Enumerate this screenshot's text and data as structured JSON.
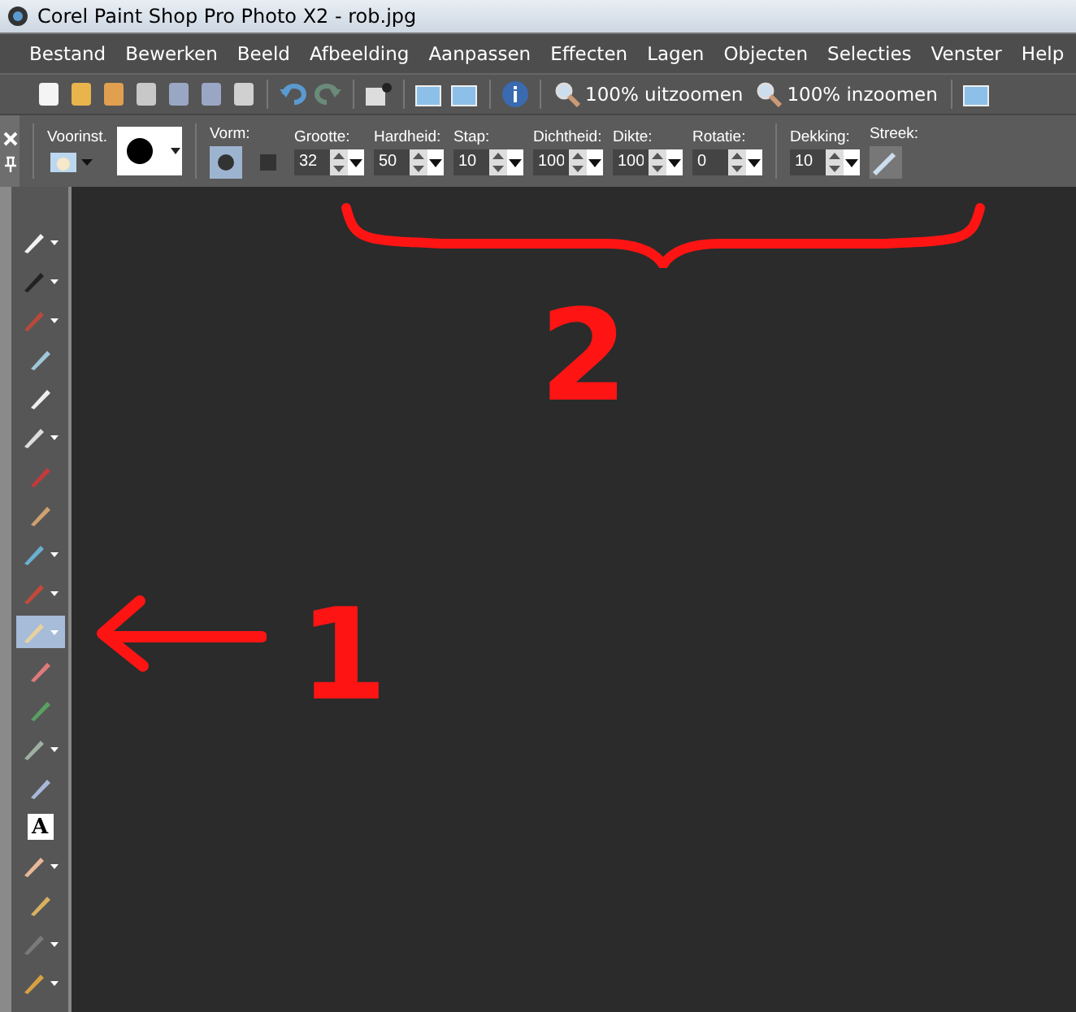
{
  "window": {
    "title": "Corel Paint Shop Pro Photo X2 - rob.jpg"
  },
  "menu": [
    "Bestand",
    "Bewerken",
    "Beeld",
    "Afbeelding",
    "Aanpassen",
    "Effecten",
    "Lagen",
    "Objecten",
    "Selecties",
    "Venster",
    "Help"
  ],
  "toolbar": {
    "zoom_out": "100% uitzoomen",
    "zoom_in": "100% inzoomen"
  },
  "options": {
    "preset_label": "Voorinst.",
    "shape_label": "Vorm:",
    "shapes": [
      {
        "selected": true
      },
      {
        "selected": false
      }
    ],
    "fields": [
      {
        "label": "Grootte:",
        "value": "32"
      },
      {
        "label": "Hardheid:",
        "value": "50"
      },
      {
        "label": "Stap:",
        "value": "10"
      },
      {
        "label": "Dichtheid:",
        "value": "100"
      },
      {
        "label": "Dikte:",
        "value": "100"
      },
      {
        "label": "Rotatie:",
        "value": "0"
      }
    ],
    "opacity": {
      "label": "Dekking:",
      "value": "10"
    },
    "stroke_label": "Streek:"
  },
  "tools": [
    {
      "dropdown": true,
      "selected": false
    },
    {
      "dropdown": true,
      "selected": false
    },
    {
      "dropdown": true,
      "selected": false
    },
    {
      "dropdown": false,
      "selected": false
    },
    {
      "dropdown": false,
      "selected": false
    },
    {
      "dropdown": true,
      "selected": false
    },
    {
      "dropdown": false,
      "selected": false
    },
    {
      "dropdown": false,
      "selected": false
    },
    {
      "dropdown": true,
      "selected": false
    },
    {
      "dropdown": true,
      "selected": false
    },
    {
      "dropdown": true,
      "selected": true
    },
    {
      "dropdown": false,
      "selected": false
    },
    {
      "dropdown": false,
      "selected": false
    },
    {
      "dropdown": true,
      "selected": false
    },
    {
      "dropdown": false,
      "selected": false
    },
    {
      "dropdown": false,
      "selected": false,
      "glyph": "A"
    },
    {
      "dropdown": true,
      "selected": false
    },
    {
      "dropdown": false,
      "selected": false
    },
    {
      "dropdown": true,
      "selected": false
    },
    {
      "dropdown": true,
      "selected": false
    }
  ],
  "annotations": [
    {
      "label": "2"
    },
    {
      "label": "1"
    }
  ]
}
